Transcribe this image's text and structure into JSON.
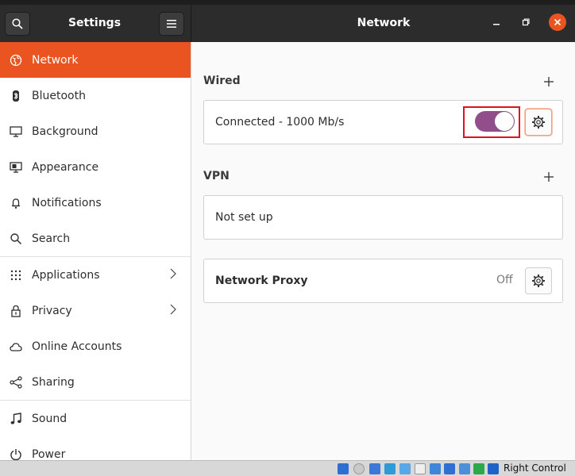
{
  "window": {
    "sidebar_title": "Settings",
    "page_title": "Network"
  },
  "sidebar": {
    "items": [
      {
        "label": "Network",
        "icon": "network-icon",
        "active": true
      },
      {
        "label": "Bluetooth",
        "icon": "bluetooth-icon"
      },
      {
        "label": "Background",
        "icon": "background-icon"
      },
      {
        "label": "Appearance",
        "icon": "appearance-icon"
      },
      {
        "label": "Notifications",
        "icon": "bell-icon"
      },
      {
        "label": "Search",
        "icon": "search-icon"
      },
      {
        "label": "Applications",
        "icon": "apps-grid-icon",
        "has_submenu": true
      },
      {
        "label": "Privacy",
        "icon": "lock-icon",
        "has_submenu": true
      },
      {
        "label": "Online Accounts",
        "icon": "cloud-icon"
      },
      {
        "label": "Sharing",
        "icon": "share-icon"
      },
      {
        "label": "Sound",
        "icon": "music-note-icon"
      },
      {
        "label": "Power",
        "icon": "power-icon"
      }
    ]
  },
  "wired": {
    "title": "Wired",
    "connection_label": "Connected - 1000 Mb/s",
    "enabled": true
  },
  "vpn": {
    "title": "VPN",
    "status": "Not set up"
  },
  "proxy": {
    "label": "Network Proxy",
    "status": "Off"
  },
  "taskbar": {
    "host_key": "Right Control"
  },
  "colors": {
    "accent": "#e95420",
    "toggle_on": "#924d8b",
    "highlight": "#e01020"
  }
}
